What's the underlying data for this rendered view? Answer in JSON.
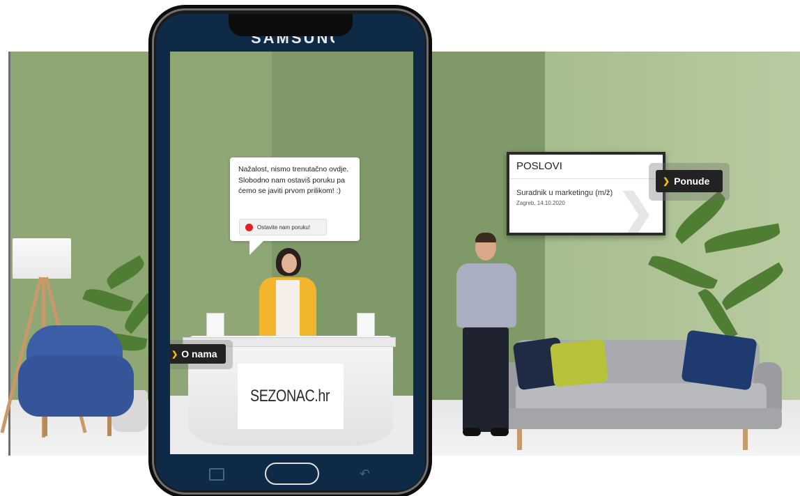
{
  "phone": {
    "brand": "SAMSUNG"
  },
  "chat_bubble": {
    "message": "Nažalost, nismo trenutačno ovdje. Slobodno nam ostaviš poruku pa ćemo se javiti prvom prilikom! :)",
    "button_label": "Ostavite nam poruku!"
  },
  "about_button": {
    "label": "O nama"
  },
  "desk_logo": {
    "text": "SEZONAC.hr"
  },
  "jobs_board": {
    "header": "POSLOVI",
    "job_title": "Suradnik u marketingu (m/ž)",
    "job_meta": "Zagreb, 14.10.2020",
    "offers_button": "Ponude"
  },
  "colors": {
    "wall": "#8ea775",
    "wall_dark": "#7f9a68",
    "accent_arrow": "#f2c200",
    "button_dark": "#222222",
    "record_dot": "#e02020"
  }
}
